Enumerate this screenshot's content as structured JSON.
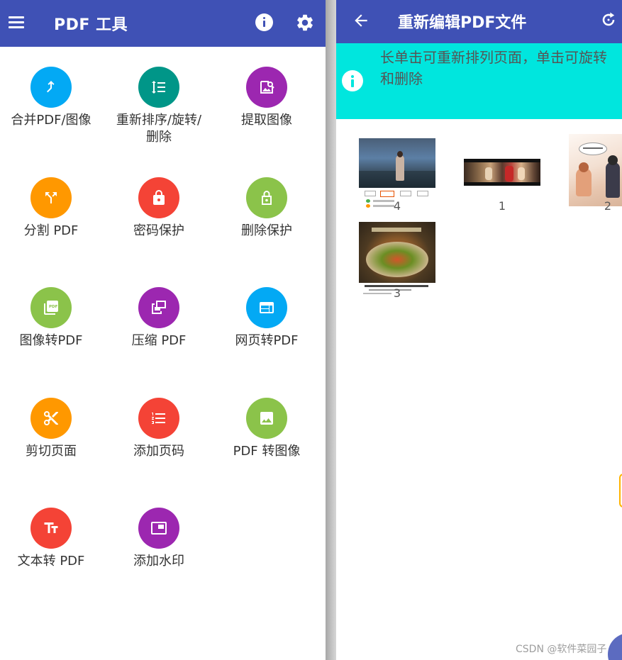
{
  "left": {
    "title": "PDF 工具",
    "menu_icon": "hamburger-menu-icon",
    "info_icon": "info-icon",
    "settings_icon": "gear-icon",
    "appbar_color": "#3f51b5",
    "tools": [
      {
        "label": "合并PDF/图像",
        "icon": "merge-icon",
        "color": "#03a9f4"
      },
      {
        "label": "重新排序/旋转/删除",
        "label_line1": "重新排序/旋转/",
        "label_line2": "删除",
        "icon": "reorder-icon",
        "color": "#009688"
      },
      {
        "label": "提取图像",
        "icon": "extract-image-icon",
        "color": "#9c27b0"
      },
      {
        "label": "分割 PDF",
        "icon": "split-icon",
        "color": "#ff9800"
      },
      {
        "label": "密码保护",
        "icon": "lock-icon",
        "color": "#f44336"
      },
      {
        "label": "删除保护",
        "icon": "unlock-icon",
        "color": "#8bc34a"
      },
      {
        "label": "图像转PDF",
        "icon": "image-to-pdf-icon",
        "color": "#8bc34a"
      },
      {
        "label": "压缩 PDF",
        "icon": "compress-icon",
        "color": "#9c27b0"
      },
      {
        "label": "网页转PDF",
        "icon": "web-icon",
        "color": "#03a9f4"
      },
      {
        "label": "剪切页面",
        "icon": "scissors-icon",
        "color": "#ff9800"
      },
      {
        "label": "添加页码",
        "icon": "numbered-list-icon",
        "color": "#f44336"
      },
      {
        "label": "PDF 转图像",
        "icon": "image-icon",
        "color": "#8bc34a"
      },
      {
        "label": "文本转 PDF",
        "icon": "text-icon",
        "color": "#f44336"
      },
      {
        "label": "添加水印",
        "icon": "watermark-icon",
        "color": "#9c27b0"
      }
    ]
  },
  "right": {
    "title": "重新编辑PDF文件",
    "back_icon": "arrow-back-icon",
    "rotate_icon": "rotate-icon",
    "banner": {
      "line1": "长单击可重新排列页面，单击可旋转",
      "line2": "和删除",
      "color": "#00e6de"
    },
    "pages": [
      {
        "number": "4"
      },
      {
        "number": "1"
      },
      {
        "number": "2"
      },
      {
        "number": "3"
      }
    ]
  },
  "watermark": "CSDN @软件菜园子"
}
